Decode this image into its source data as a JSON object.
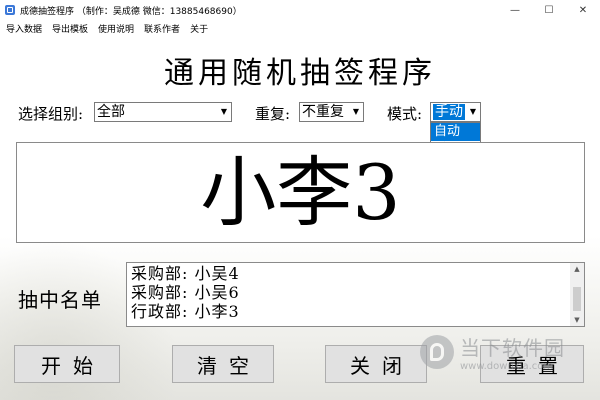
{
  "window": {
    "title": "成德抽签程序 （制作：吴成德 微信：13885468690）",
    "minimize": "—",
    "maximize": "☐",
    "close": "✕"
  },
  "menu": [
    "导入数据",
    "导出模板",
    "使用说明",
    "联系作者",
    "关于"
  ],
  "heading": "通用随机抽签程序",
  "controls": {
    "group_label": "选择组别:",
    "group_value": "全部",
    "repeat_label": "重复:",
    "repeat_value": "不重复",
    "mode_label": "模式:",
    "mode_value": "手动",
    "mode_options": [
      "自动",
      "手动"
    ]
  },
  "result": "小李3",
  "drawn_list": {
    "label": "抽中名单",
    "items": [
      "采购部: 小吴4",
      "采购部: 小吴6",
      "行政部: 小李3"
    ]
  },
  "buttons": {
    "start": "开始",
    "clear": "清空",
    "close": "关闭",
    "reset": "重置"
  },
  "watermark": {
    "main": "当下软件园",
    "sub": "www.downxia.com"
  },
  "colors": {
    "accent": "#0078d7",
    "button_bg": "#e1e1e1"
  }
}
